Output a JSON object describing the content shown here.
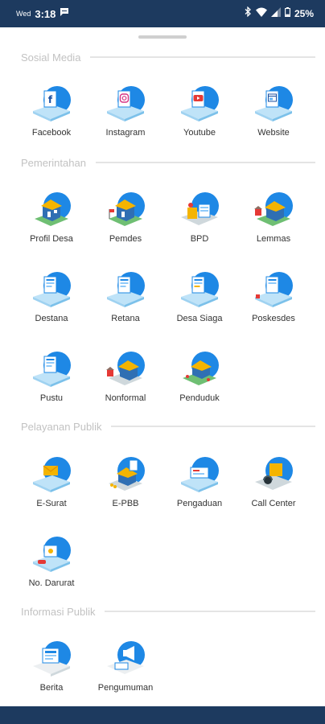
{
  "status_bar": {
    "day": "Wed",
    "time": "3:18",
    "battery": "25%",
    "icons": [
      "message-icon",
      "bluetooth-icon",
      "wifi-icon",
      "signal-icon",
      "battery-icon"
    ]
  },
  "colors": {
    "status_bar_bg": "#1d3a5f",
    "icon_blue": "#1e88e5",
    "section_title": "#c2c2c2",
    "divider": "#e4e4e4"
  },
  "sections": [
    {
      "title": "Sosial Media",
      "items": [
        {
          "label": "Facebook",
          "icon": "facebook-icon"
        },
        {
          "label": "Instagram",
          "icon": "instagram-icon"
        },
        {
          "label": "Youtube",
          "icon": "youtube-icon"
        },
        {
          "label": "Website",
          "icon": "website-icon"
        }
      ]
    },
    {
      "title": "Pemerintahan",
      "items": [
        {
          "label": "Profil Desa",
          "icon": "profil-desa-icon"
        },
        {
          "label": "Pemdes",
          "icon": "pemdes-icon"
        },
        {
          "label": "BPD",
          "icon": "bpd-icon"
        },
        {
          "label": "Lemmas",
          "icon": "lemmas-icon"
        },
        {
          "label": "Destana",
          "icon": "destana-icon"
        },
        {
          "label": "Retana",
          "icon": "retana-icon"
        },
        {
          "label": "Desa Siaga",
          "icon": "desa-siaga-icon"
        },
        {
          "label": "Poskesdes",
          "icon": "poskesdes-icon"
        },
        {
          "label": "Pustu",
          "icon": "pustu-icon"
        },
        {
          "label": "Nonformal",
          "icon": "nonformal-icon"
        },
        {
          "label": "Penduduk",
          "icon": "penduduk-icon"
        }
      ]
    },
    {
      "title": "Pelayanan Publik",
      "items": [
        {
          "label": "E-Surat",
          "icon": "e-surat-icon"
        },
        {
          "label": "E-PBB",
          "icon": "e-pbb-icon"
        },
        {
          "label": "Pengaduan",
          "icon": "pengaduan-icon"
        },
        {
          "label": "Call Center",
          "icon": "call-center-icon"
        },
        {
          "label": "No. Darurat",
          "icon": "no-darurat-icon"
        }
      ]
    },
    {
      "title": "Informasi Publik",
      "items": [
        {
          "label": "Berita",
          "icon": "berita-icon"
        },
        {
          "label": "Pengumuman",
          "icon": "pengumuman-icon"
        }
      ]
    }
  ]
}
